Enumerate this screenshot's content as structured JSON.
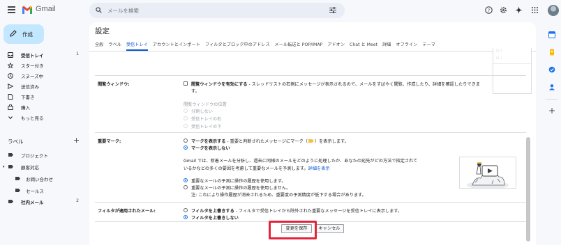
{
  "app": {
    "name": "Gmail"
  },
  "search": {
    "placeholder": "メールを検索"
  },
  "compose_label": "作成",
  "nav": [
    {
      "label": "受信トレイ",
      "count": "1",
      "bold": true
    },
    {
      "label": "スター付き",
      "count": ""
    },
    {
      "label": "スヌーズ中",
      "count": ""
    },
    {
      "label": "送信済み",
      "count": ""
    },
    {
      "label": "下書き",
      "count": ""
    },
    {
      "label": "購入",
      "count": ""
    },
    {
      "label": "もっと見る",
      "count": ""
    }
  ],
  "labels": {
    "heading": "ラベル",
    "add": "+",
    "items": [
      {
        "label": "プロジェクト",
        "count": ""
      },
      {
        "label": "顧客対応",
        "count": ""
      },
      {
        "label": "お問い合わせ",
        "count": ""
      },
      {
        "label": "セールス",
        "count": ""
      },
      {
        "label": "社内メール",
        "count": "2",
        "bold": true
      }
    ]
  },
  "settings": {
    "title": "設定",
    "tabs": [
      "全般",
      "ラベル",
      "受信トレイ",
      "アカウントとインポート",
      "フィルタとブロック中のアドレス",
      "メール転送と POP/IMAP",
      "アドオン",
      "Chat と Meet",
      "詳細",
      "オフライン",
      "テーマ"
    ],
    "active_tab": "受信トレイ",
    "reading_pane": {
      "title": "閲覧ウィンドウ:",
      "checkbox_bold": "閲覧ウィンドウを有効にする",
      "checkbox_rest": " - スレッドリストの右側にメッセージが表示されるので、メールをすばやく閲覧、作成したり、詳細を確認したりできま",
      "checkbox_wrap": "す。",
      "position_label": "閲覧ウィンドウの位置",
      "positions": [
        "分割しない",
        "受信トレイの右",
        "受信トレイの下"
      ]
    },
    "importance": {
      "title": "重要マーク:",
      "opt1_bold": "マークを表示する",
      "opt1_rest_a": " - 重要と判断されたメッセージにマーク（",
      "opt1_rest_b": "）を表示します。",
      "opt2_bold": "マークを表示しない",
      "desc1": "Gmail では、新着メールを分析し、過去に同様のメールをどのように処理したか、あなたの宛先がどの方法で指定されて",
      "desc2": "いるかなどの多くの要因を考慮して重要なメールを予測します。",
      "desc_link": "詳細を表示",
      "past_use": "重要なメールの予測に操作の履歴を使用します。",
      "past_nouse": "重要なメールの予測に操作の履歴を使用しません。",
      "note": "注: これにより操作履歴が消去されるため、重要度の予測精度が低下する場合があります。"
    },
    "filtered": {
      "title": "フィルタが適用されたメール:",
      "opt1_bold": "フィルタを上書きする",
      "opt1_rest": " - フィルタで受信トレイから除外された重要なメッセージを受信トレイに表示します。",
      "opt2_bold": "フィルタを上書きしない"
    },
    "buttons": {
      "save": "変更を保存",
      "cancel": "キャンセル"
    }
  },
  "colors": {
    "accent": "#0b57d0",
    "highlight": "#e3243b",
    "compose_bg": "#c2e7ff",
    "important_marker": "#f6c23e"
  }
}
